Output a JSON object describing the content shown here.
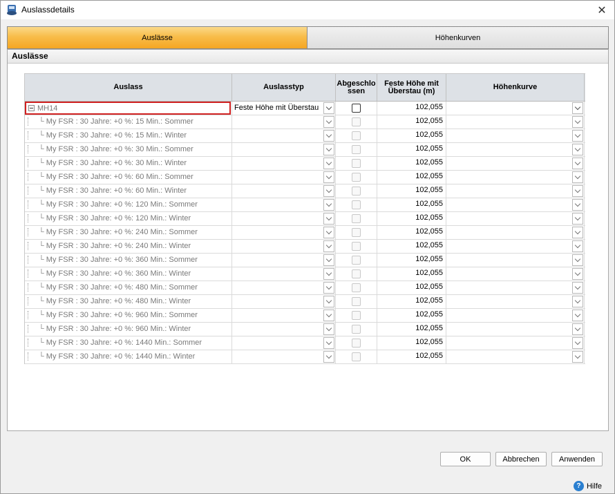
{
  "window": {
    "title": "Auslassdetails",
    "close_glyph": "✕"
  },
  "tabs": [
    {
      "label": "Auslässe",
      "active": true
    },
    {
      "label": "Höhenkurven",
      "active": false
    }
  ],
  "panel": {
    "title": "Auslässe"
  },
  "grid": {
    "columns": [
      "Auslass",
      "Auslasstyp",
      "Abgeschlo ssen",
      "Feste Höhe mit Überstau (m)",
      "Höhenkurve"
    ],
    "parent": {
      "name": "MH14",
      "type": "Feste Höhe mit Überstau",
      "closed": false,
      "height": "102,055",
      "curve": ""
    },
    "children": [
      {
        "name": "My FSR : 30 Jahre: +0 %: 15 Min.: Sommer",
        "height": "102,055"
      },
      {
        "name": "My FSR : 30 Jahre: +0 %: 15 Min.: Winter",
        "height": "102,055"
      },
      {
        "name": "My FSR : 30 Jahre: +0 %: 30 Min.: Sommer",
        "height": "102,055"
      },
      {
        "name": "My FSR : 30 Jahre: +0 %: 30 Min.: Winter",
        "height": "102,055"
      },
      {
        "name": "My FSR : 30 Jahre: +0 %: 60 Min.: Sommer",
        "height": "102,055"
      },
      {
        "name": "My FSR : 30 Jahre: +0 %: 60 Min.: Winter",
        "height": "102,055"
      },
      {
        "name": "My FSR : 30 Jahre: +0 %: 120 Min.: Sommer",
        "height": "102,055"
      },
      {
        "name": "My FSR : 30 Jahre: +0 %: 120 Min.: Winter",
        "height": "102,055"
      },
      {
        "name": "My FSR : 30 Jahre: +0 %: 240 Min.: Sommer",
        "height": "102,055"
      },
      {
        "name": "My FSR : 30 Jahre: +0 %: 240 Min.: Winter",
        "height": "102,055"
      },
      {
        "name": "My FSR : 30 Jahre: +0 %: 360 Min.: Sommer",
        "height": "102,055"
      },
      {
        "name": "My FSR : 30 Jahre: +0 %: 360 Min.: Winter",
        "height": "102,055"
      },
      {
        "name": "My FSR : 30 Jahre: +0 %: 480 Min.: Sommer",
        "height": "102,055"
      },
      {
        "name": "My FSR : 30 Jahre: +0 %: 480 Min.: Winter",
        "height": "102,055"
      },
      {
        "name": "My FSR : 30 Jahre: +0 %: 960 Min.: Sommer",
        "height": "102,055"
      },
      {
        "name": "My FSR : 30 Jahre: +0 %: 960 Min.: Winter",
        "height": "102,055"
      },
      {
        "name": "My FSR : 30 Jahre: +0 %: 1440 Min.: Sommer",
        "height": "102,055"
      },
      {
        "name": "My FSR : 30 Jahre: +0 %: 1440 Min.: Winter",
        "height": "102,055"
      }
    ]
  },
  "buttons": {
    "ok": "OK",
    "cancel": "Abbrechen",
    "apply": "Anwenden"
  },
  "help": {
    "label": "Hilfe",
    "glyph": "?"
  },
  "colors": {
    "active_tab": "#f5a623",
    "selection_border": "#d02020",
    "header_bg": "#dde1e6"
  }
}
